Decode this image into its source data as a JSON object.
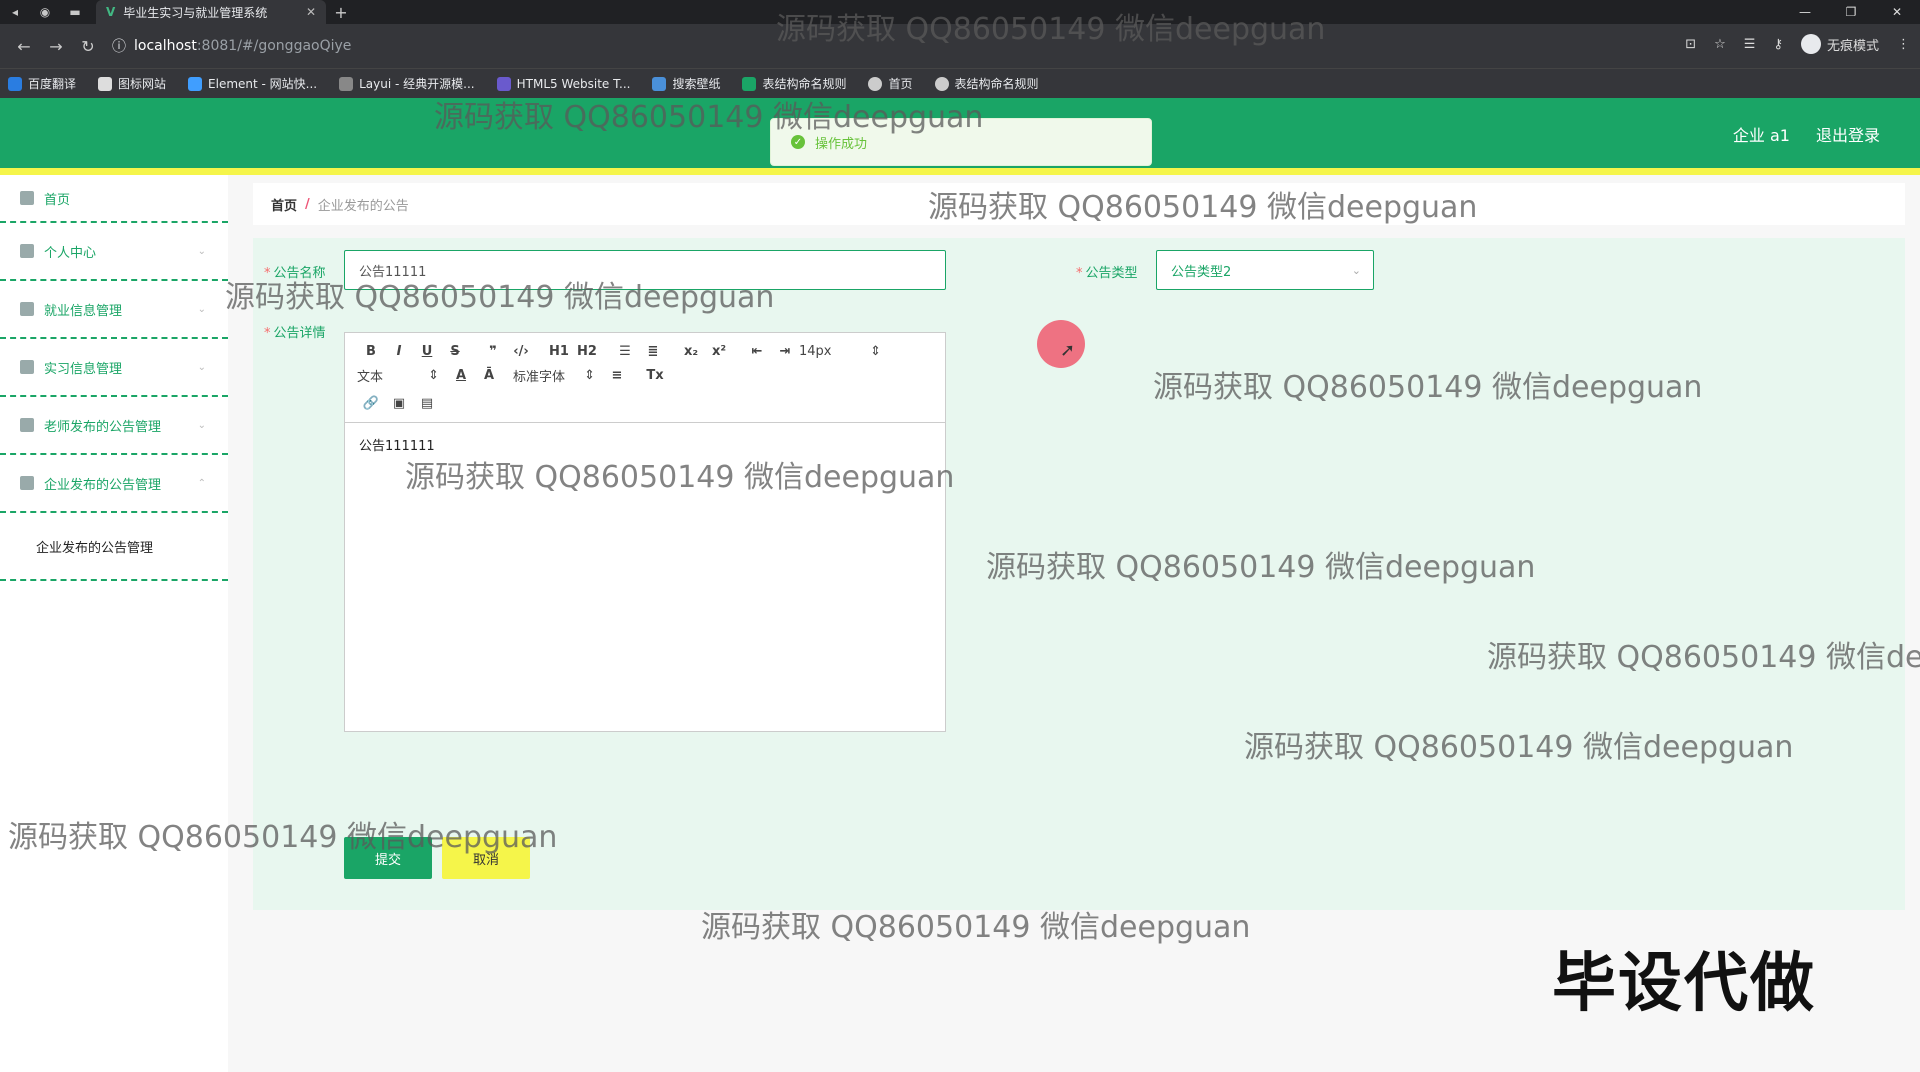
{
  "browser": {
    "tab_title": "毕业生实习与就业管理系统",
    "url_host": "localhost",
    "url_path": ":8081/#/gonggaoQiye",
    "incognito_label": "无痕模式",
    "bookmarks": [
      "百度翻译",
      "图标网站",
      "Element - 网站快...",
      "Layui - 经典开源模...",
      "HTML5 Website T...",
      "搜索壁纸",
      "表结构命名规则",
      "首页",
      "表结构命名规则"
    ]
  },
  "header": {
    "user_label": "企业 a1",
    "logout_label": "退出登录",
    "toast_text": "操作成功"
  },
  "sidebar": {
    "items": [
      {
        "label": "首页"
      },
      {
        "label": "个人中心"
      },
      {
        "label": "就业信息管理"
      },
      {
        "label": "实习信息管理"
      },
      {
        "label": "老师发布的公告管理"
      },
      {
        "label": "企业发布的公告管理"
      }
    ],
    "submenu_label": "企业发布的公告管理"
  },
  "breadcrumb": {
    "home": "首页",
    "separator": "/",
    "current": "企业发布的公告"
  },
  "form": {
    "name_label": "公告名称",
    "name_value": "公告11111",
    "type_label": "公告类型",
    "type_value": "公告类型2",
    "detail_label": "公告详情",
    "editor": {
      "font_size": "14px",
      "block_format": "文本",
      "font_family": "标准字体",
      "h1": "H1",
      "h2": "H2",
      "content": "公告111111"
    },
    "submit_label": "提交",
    "cancel_label": "取消"
  },
  "overlay": {
    "watermark": "源码获取 QQ86050149 微信deepguan",
    "watermark_cut": "源码获取 QQ86050149 微信dee",
    "big_tag": "毕设代做"
  }
}
